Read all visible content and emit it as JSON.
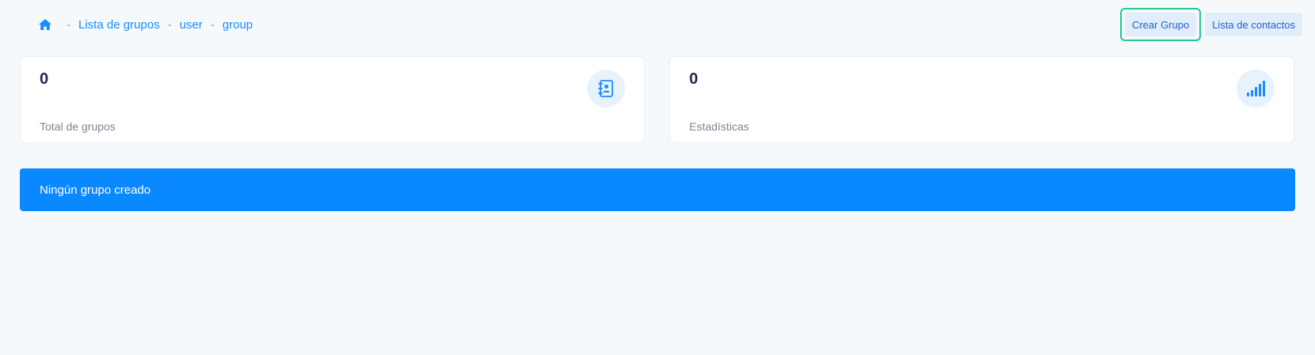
{
  "breadcrumb": {
    "home_icon": "home-icon",
    "separator": "-",
    "items": [
      "Lista de grupos",
      "user",
      "group"
    ]
  },
  "actions": {
    "create_group": "Crear Grupo",
    "contact_list": "Lista de contactos"
  },
  "cards": [
    {
      "value": "0",
      "label": "Total de grupos",
      "icon": "address-book-icon"
    },
    {
      "value": "0",
      "label": "Estadísticas",
      "icon": "signal-bars-icon"
    }
  ],
  "alert": {
    "message": "Ningún grupo creado"
  },
  "colors": {
    "accent": "#0a88fd",
    "background": "#f5f9fc",
    "highlight_border": "#23c98e",
    "button_bg": "#e1edfb",
    "button_text": "#1f63c6"
  }
}
